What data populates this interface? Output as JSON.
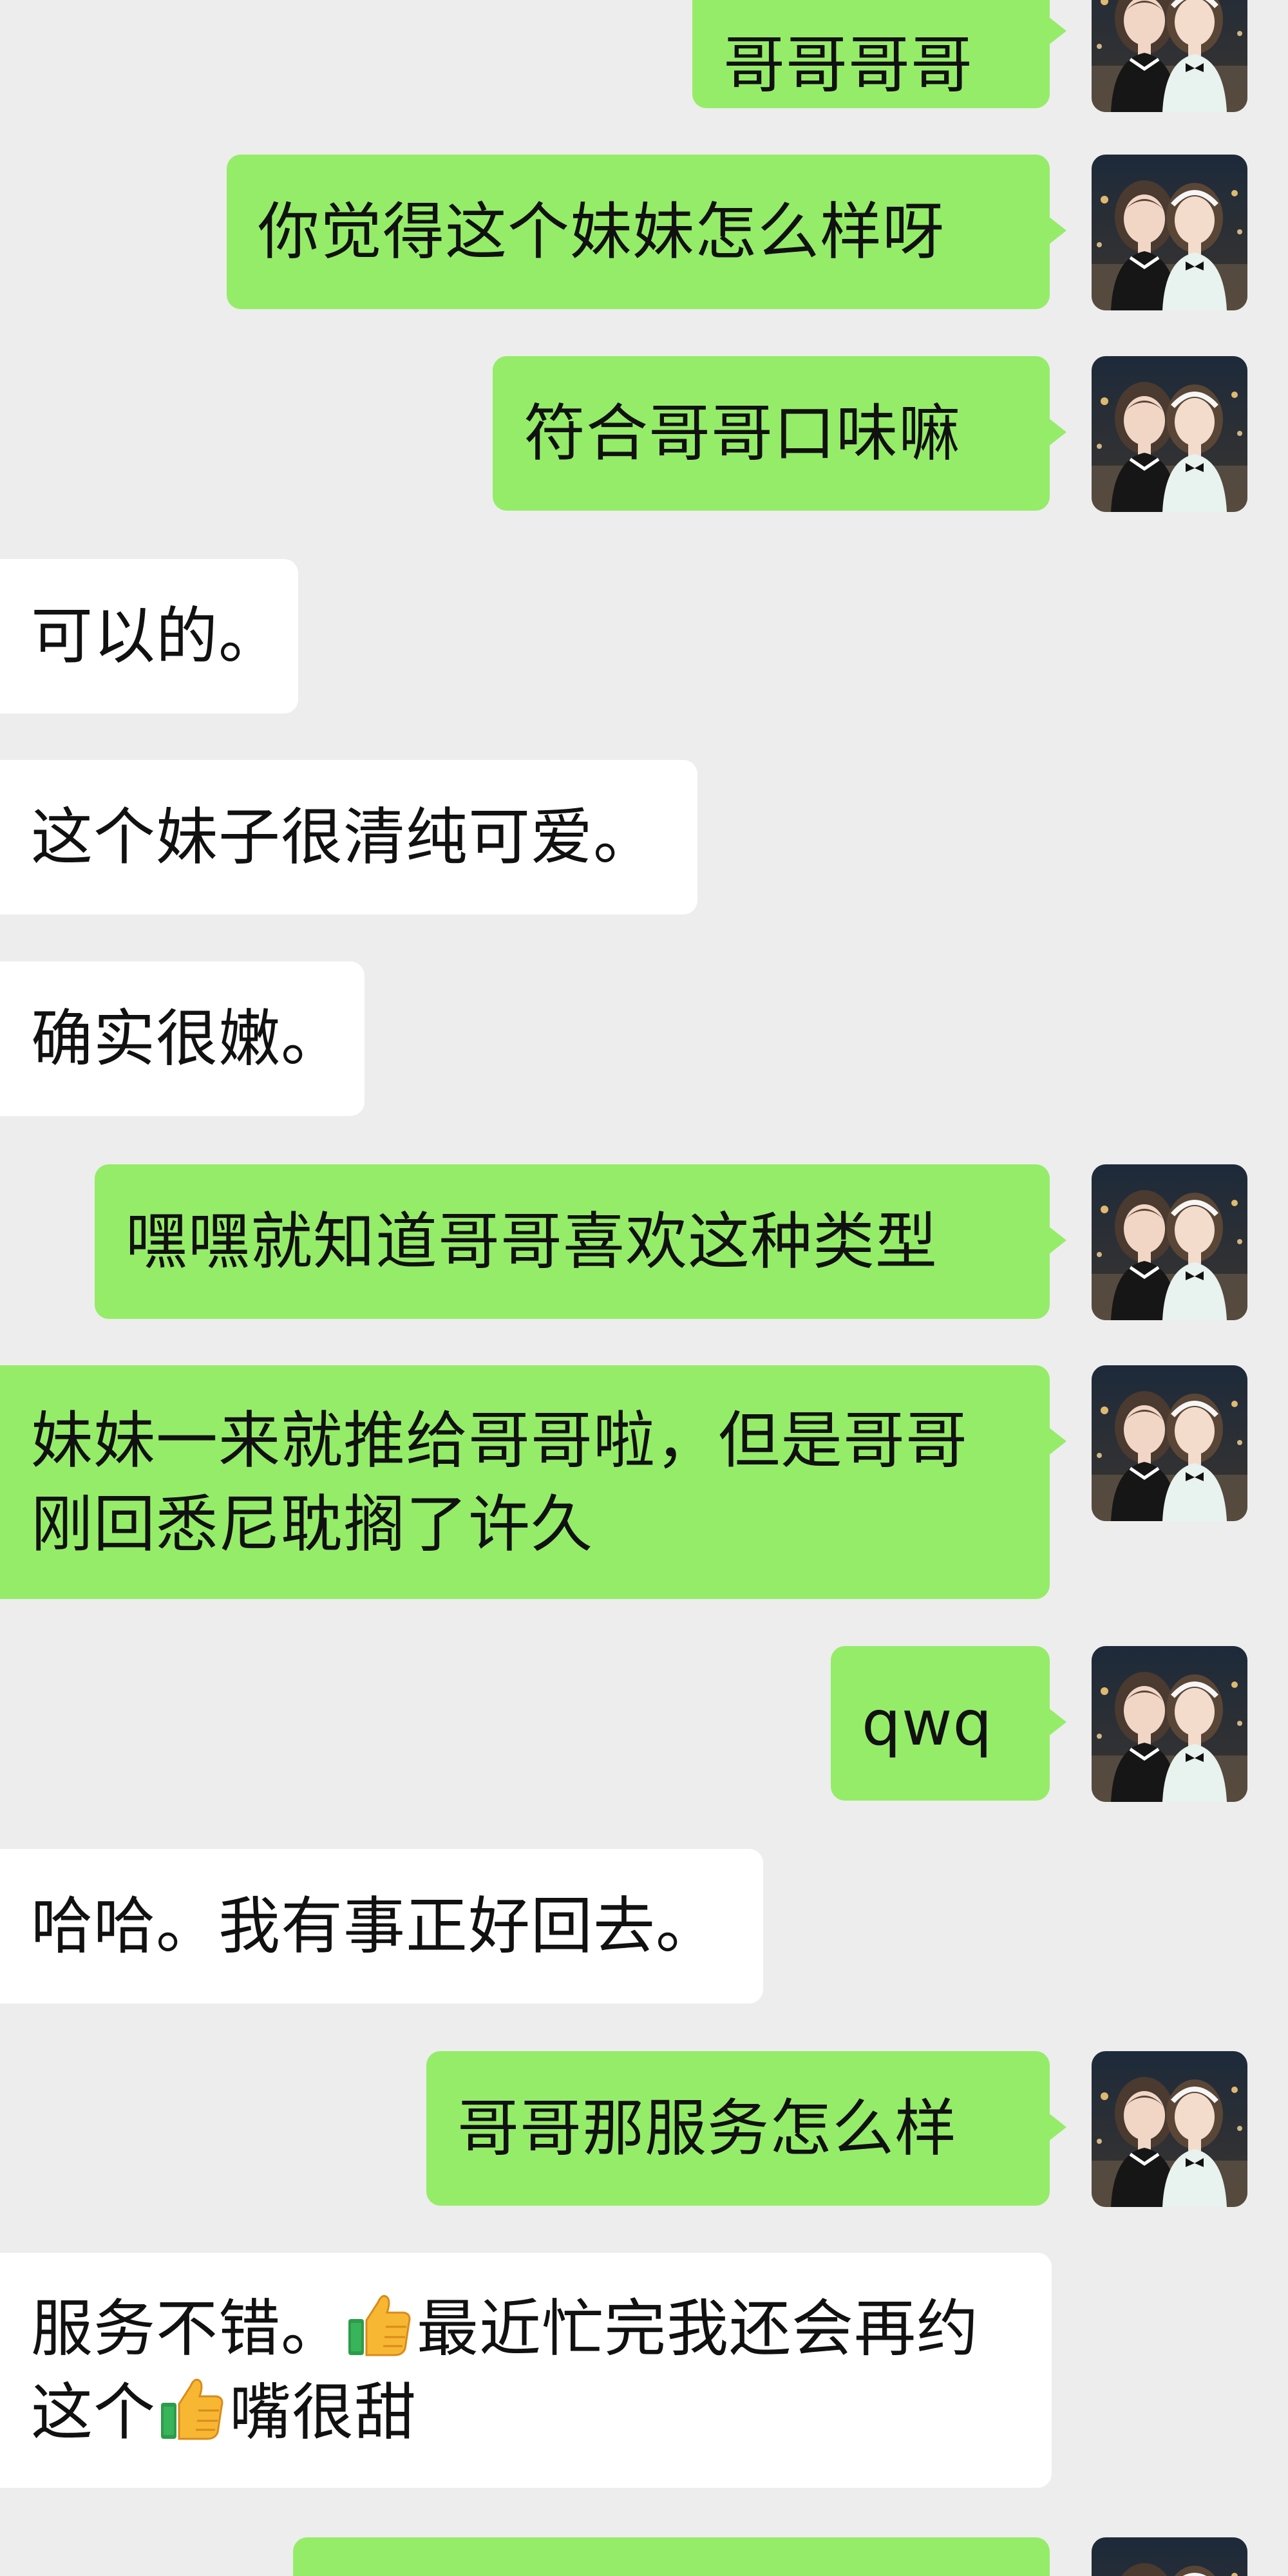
{
  "messages": [
    {
      "from": "me",
      "text": "哥哥哥哥"
    },
    {
      "from": "me",
      "text": "你觉得这个妹妹怎么样呀"
    },
    {
      "from": "me",
      "text": "符合哥哥口味嘛"
    },
    {
      "from": "other",
      "text": "可以的。"
    },
    {
      "from": "other",
      "text": "这个妹子很清纯可爱。"
    },
    {
      "from": "other",
      "text": "确实很嫩。"
    },
    {
      "from": "me",
      "text": "嘿嘿就知道哥哥喜欢这种类型"
    },
    {
      "from": "me",
      "line1": "妹妹一来就推给哥哥啦，但是哥哥",
      "line2": "刚回悉尼耽搁了许久"
    },
    {
      "from": "me",
      "text": "qwq"
    },
    {
      "from": "other",
      "text": "哈哈。我有事正好回去。"
    },
    {
      "from": "me",
      "text": "哥哥那服务怎么样"
    },
    {
      "from": "other",
      "line1_a": "服务不错。",
      "line1_b": "最近忙完我还会再约",
      "line2_a": "这个",
      "line2_b": "嘴很甜",
      "emoji": "thumbs-up-icon"
    }
  ],
  "colors": {
    "background": "#ededed",
    "outgoing_bubble": "#95ec69",
    "incoming_bubble": "#ffffff",
    "text": "#111111"
  },
  "avatar": {
    "icon": "avatar-photo-two-girls"
  }
}
